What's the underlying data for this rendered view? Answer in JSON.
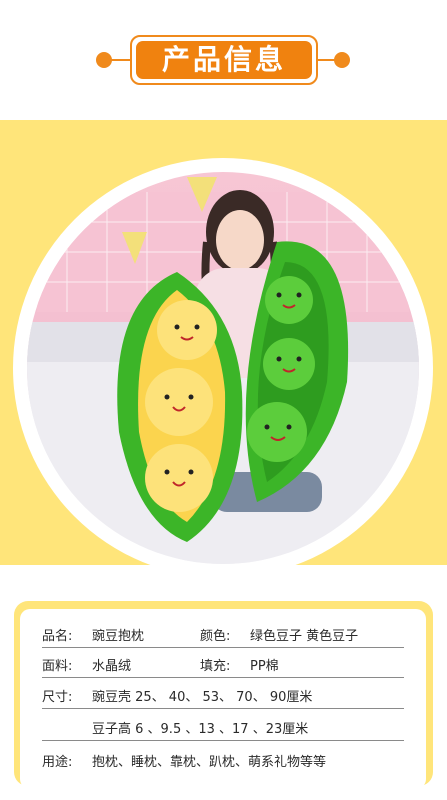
{
  "header": {
    "title": "产品信息"
  },
  "colors": {
    "accent": "#f0820f",
    "band": "#ffe57a",
    "pea_green": "#3cb528",
    "pea_yellow": "#fbd44e"
  },
  "photo": {
    "icon": "pea-pillow-photo"
  },
  "info": {
    "name_label": "品名:",
    "name_value": "豌豆抱枕",
    "color_label": "颜色:",
    "color_value": "绿色豆子 黄色豆子",
    "fabric_label": "面料:",
    "fabric_value": "水晶绒",
    "filling_label": "填充:",
    "filling_value": "PP棉",
    "size_label": "尺寸:",
    "size_shell": "豌豆壳 25、 40、 53、 70、 90厘米",
    "size_bean": "豆子高 6 、9.5 、13 、17 、23厘米",
    "use_label": "用途:",
    "use_value": "抱枕、睡枕、靠枕、趴枕、萌系礼物等等"
  }
}
